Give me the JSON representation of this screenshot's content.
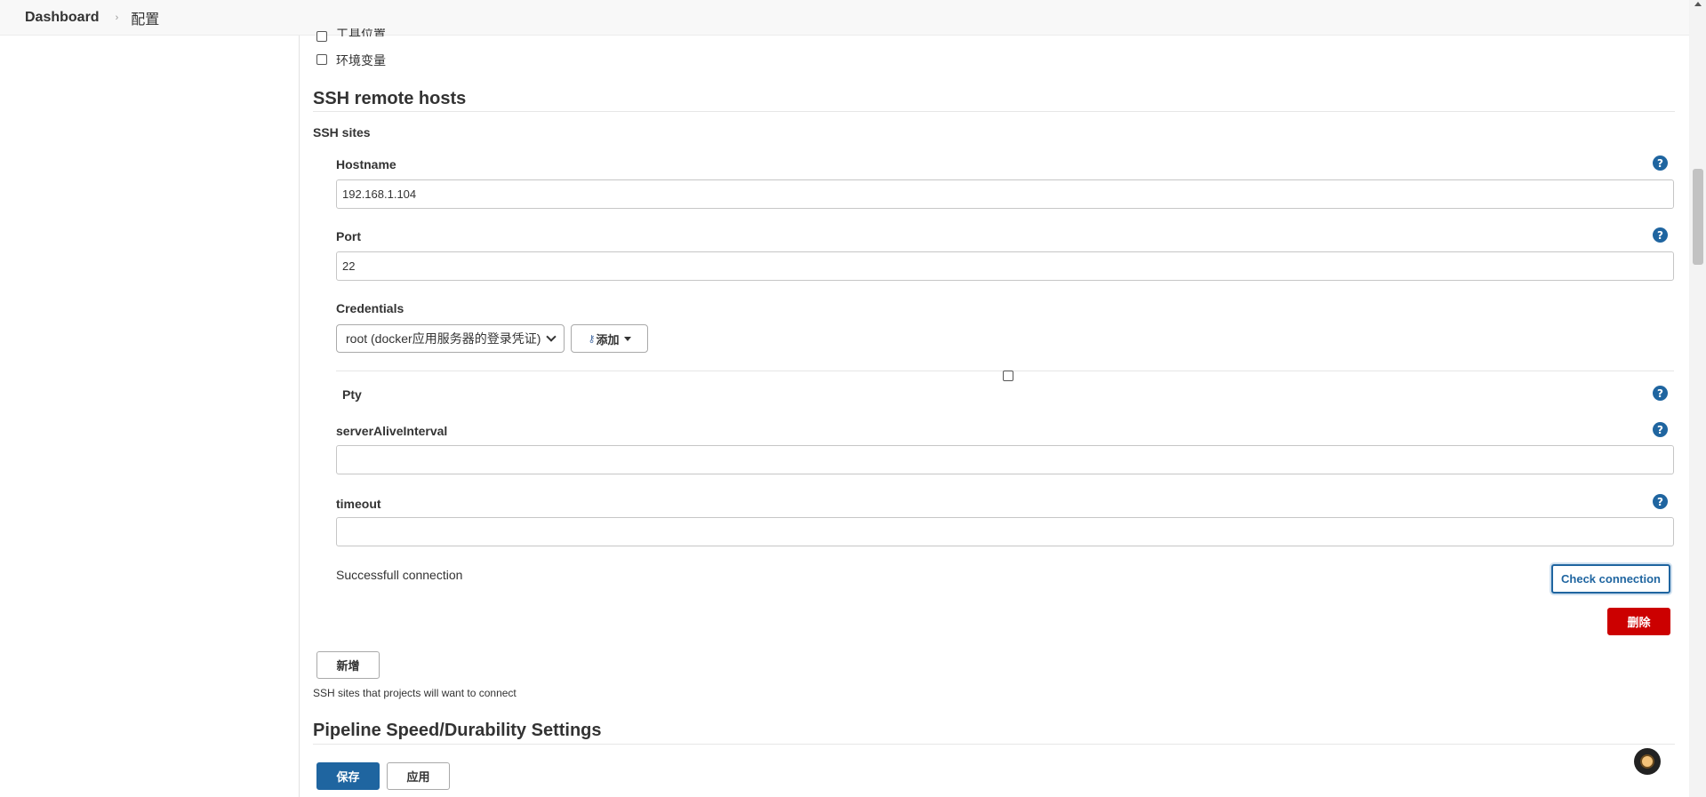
{
  "breadcrumb": {
    "root": "Dashboard",
    "separator": "›",
    "current": "配置"
  },
  "options": {
    "tool_locations_label": "工具位置",
    "env_vars_label": "环境变量"
  },
  "ssh": {
    "section_title": "SSH remote hosts",
    "sites_label": "SSH sites",
    "hostname_label": "Hostname",
    "hostname_value": "192.168.1.104",
    "port_label": "Port",
    "port_value": "22",
    "credentials_label": "Credentials",
    "credentials_selected": "root (docker应用服务器的登录凭证)",
    "add_label": "添加",
    "pty_label": "Pty",
    "server_alive_label": "serverAliveInterval",
    "server_alive_value": "",
    "timeout_label": "timeout",
    "timeout_value": "",
    "status_text": "Successfull connection",
    "check_connection_label": "Check connection",
    "delete_label": "删除",
    "new_label": "新增",
    "sites_help_text": "SSH sites that projects will want to connect"
  },
  "pipeline": {
    "section_title": "Pipeline Speed/Durability Settings"
  },
  "footer": {
    "save_label": "保存",
    "apply_label": "应用"
  },
  "icons": {
    "help": "?",
    "key": "key-icon"
  },
  "colors": {
    "primary": "#1f65a0",
    "danger": "#cc0000"
  }
}
